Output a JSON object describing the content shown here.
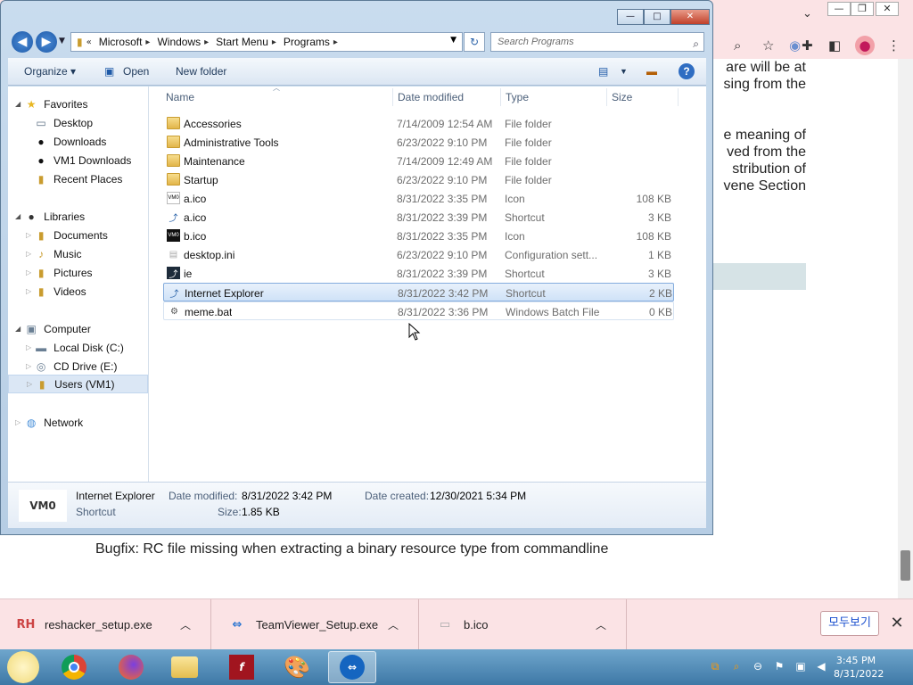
{
  "browser": {
    "web_lines": [
      "are will be at",
      "sing from the",
      "e meaning of",
      "ved from the",
      "stribution of",
      "vene Section"
    ],
    "bugfix_text": "Bugfix:  RC file missing when extracting a binary resource type from commandline",
    "downloads": [
      {
        "name": "reshacker_setup.exe",
        "icon": "RH"
      },
      {
        "name": "TeamViewer_Setup.exe",
        "icon": "TV"
      },
      {
        "name": "b.ico",
        "icon": "ico"
      }
    ],
    "show_all_label": "모두보기",
    "close_label": "✕"
  },
  "explorer": {
    "breadcrumbs": [
      "Microsoft",
      "Windows",
      "Start Menu",
      "Programs"
    ],
    "search_placeholder": "Search Programs",
    "toolbar": {
      "organize": "Organize ▾",
      "open": "Open",
      "new_folder": "New folder"
    },
    "nav": {
      "favorites": "Favorites",
      "favorites_items": [
        "Desktop",
        "Downloads",
        "VM1 Downloads",
        "Recent Places"
      ],
      "libraries": "Libraries",
      "libraries_items": [
        "Documents",
        "Music",
        "Pictures",
        "Videos"
      ],
      "computer": "Computer",
      "computer_items": [
        "Local Disk (C:)",
        "CD Drive (E:)",
        "Users (VM1)"
      ],
      "network": "Network"
    },
    "columns": {
      "name": "Name",
      "date": "Date modified",
      "type": "Type",
      "size": "Size"
    },
    "files": [
      {
        "name": "Accessories",
        "date": "7/14/2009 12:54 AM",
        "type": "File folder",
        "size": "",
        "icon": "folder"
      },
      {
        "name": "Administrative Tools",
        "date": "6/23/2022 9:10 PM",
        "type": "File folder",
        "size": "",
        "icon": "folder"
      },
      {
        "name": "Maintenance",
        "date": "7/14/2009 12:49 AM",
        "type": "File folder",
        "size": "",
        "icon": "folder"
      },
      {
        "name": "Startup",
        "date": "6/23/2022 9:10 PM",
        "type": "File folder",
        "size": "",
        "icon": "folder"
      },
      {
        "name": "a.ico",
        "date": "8/31/2022 3:35 PM",
        "type": "Icon",
        "size": "108 KB",
        "icon": "vmo"
      },
      {
        "name": "a.ico",
        "date": "8/31/2022 3:39 PM",
        "type": "Shortcut",
        "size": "3 KB",
        "icon": "shortcut"
      },
      {
        "name": "b.ico",
        "date": "8/31/2022 3:35 PM",
        "type": "Icon",
        "size": "108 KB",
        "icon": "vmo-dark"
      },
      {
        "name": "desktop.ini",
        "date": "6/23/2022 9:10 PM",
        "type": "Configuration sett...",
        "size": "1 KB",
        "icon": "ini"
      },
      {
        "name": "ie",
        "date": "8/31/2022 3:39 PM",
        "type": "Shortcut",
        "size": "3 KB",
        "icon": "shortcut-dark"
      },
      {
        "name": "Internet Explorer",
        "date": "8/31/2022 3:42 PM",
        "type": "Shortcut",
        "size": "2 KB",
        "icon": "shortcut"
      },
      {
        "name": "meme.bat",
        "date": "8/31/2022 3:36 PM",
        "type": "Windows Batch File",
        "size": "0 KB",
        "icon": "bat"
      }
    ],
    "details": {
      "thumb": "VM0",
      "name": "Internet Explorer",
      "kind": "Shortcut",
      "modified_label": "Date modified:",
      "modified": "8/31/2022 3:42 PM",
      "created_label": "Date created:",
      "created": "12/30/2021 5:34 PM",
      "size_label": "Size:",
      "size": "1.85 KB"
    }
  },
  "taskbar": {
    "time": "3:45 PM",
    "date": "8/31/2022"
  }
}
